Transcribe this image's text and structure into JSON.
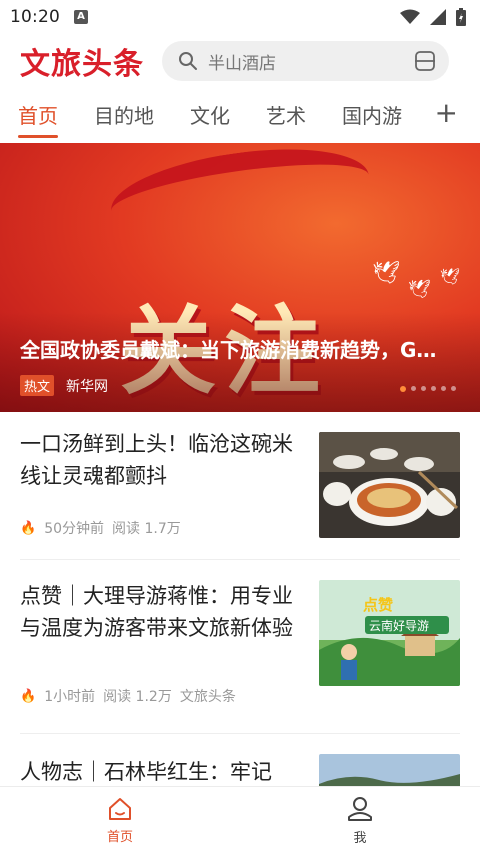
{
  "status_bar": {
    "time": "10:20",
    "notification_badge": "A"
  },
  "header": {
    "logo": "文旅头条",
    "search_placeholder": "半山酒店"
  },
  "tabs": [
    {
      "label": "首页",
      "active": true
    },
    {
      "label": "目的地",
      "active": false
    },
    {
      "label": "文化",
      "active": false
    },
    {
      "label": "艺术",
      "active": false
    },
    {
      "label": "国内游",
      "active": false
    }
  ],
  "tab_add": "+",
  "banner": {
    "image_text": "关注",
    "title": "全国政协委员戴斌：当下旅游消费新趋势，G…",
    "badge": "热文",
    "source": "新华网",
    "slide_count": 6,
    "current_slide": 1
  },
  "articles": [
    {
      "headline": "一口汤鲜到上头！临沧这碗米线让灵魂都颤抖",
      "time": "50分钟前",
      "reads": "阅读 1.7万",
      "source": ""
    },
    {
      "headline": "点赞｜大理导游蒋惟：用专业与温度为游客带来文旅新体验",
      "time": "1小时前",
      "reads": "阅读 1.2万",
      "source": "文旅头条",
      "thumb_text_1": "点赞",
      "thumb_text_2": "云南好导游"
    },
    {
      "headline": "人物志｜石林毕红生：牢记"
    }
  ],
  "bottom_nav": [
    {
      "label": "首页",
      "active": true
    },
    {
      "label": "我",
      "active": false
    }
  ],
  "colors": {
    "accent": "#e0502a",
    "logo": "#d91f2a"
  }
}
